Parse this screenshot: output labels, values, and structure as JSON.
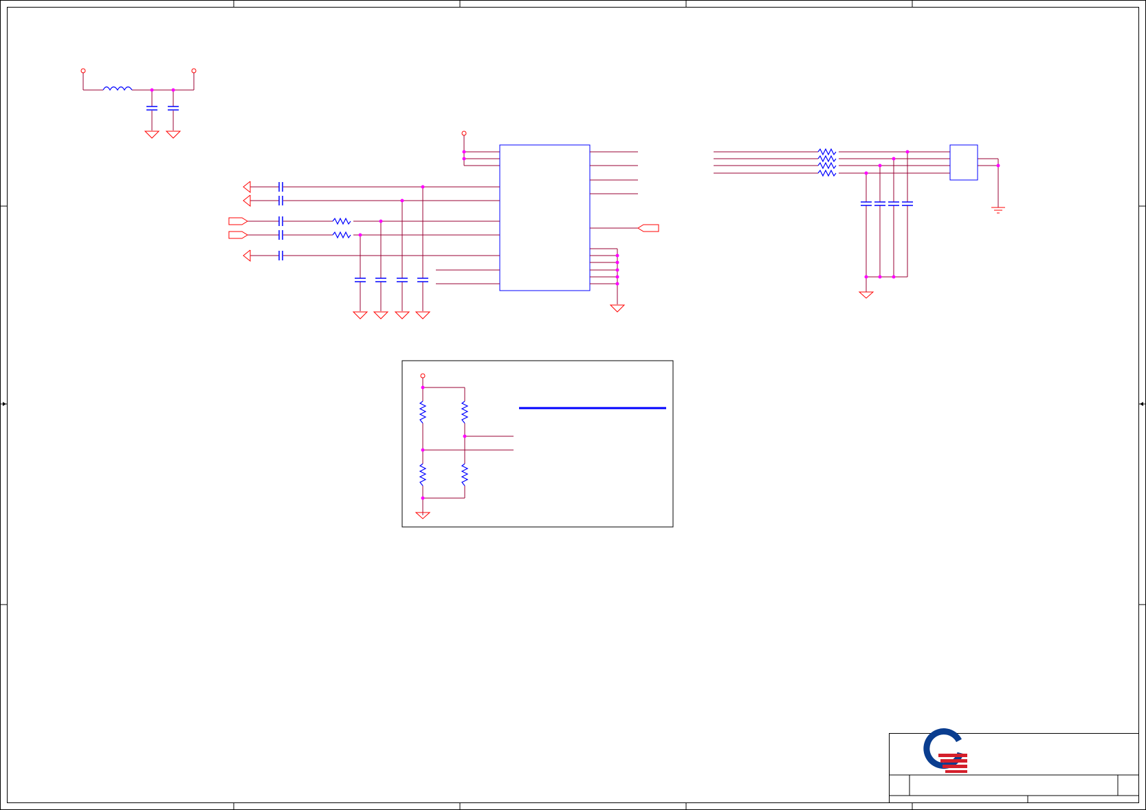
{
  "sheet": {
    "title": "",
    "company": ""
  },
  "colors": {
    "frame": "#000000",
    "wire": "#990033",
    "power": "#ff0000",
    "component": "#0000ff",
    "junction": "#ff00ff",
    "logo_blue": "#0a3d8f",
    "logo_red": "#d41f2b"
  },
  "icons": {
    "logo": "company-logo",
    "ground": "ground-icon",
    "power_pin": "power-pin-icon"
  }
}
